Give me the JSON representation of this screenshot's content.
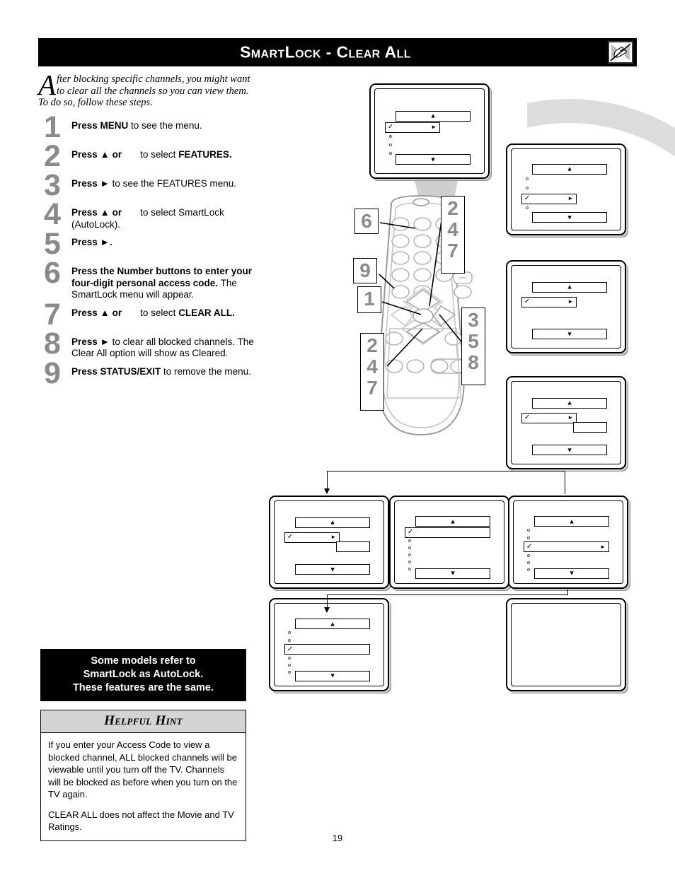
{
  "header": {
    "title": "SmartLock - Clear All",
    "icon": "tv-hand-blocked-icon"
  },
  "intro": {
    "dropcap": "A",
    "text": "fter blocking specific channels, you might want to clear all the channels so you can view them.  To do so, follow these steps."
  },
  "steps": [
    {
      "num": "1",
      "html": "<b>Press MENU</b> to see the menu."
    },
    {
      "num": "2",
      "html": "<b>Press ▲ or</b><span class=\"gap\"></span>to select <b>FEATURES.</b>"
    },
    {
      "num": "3",
      "html": "<b>Press ►</b> to see the FEATURES menu."
    },
    {
      "num": "4",
      "html": "<b>Press ▲ or</b><span class=\"gap\"></span>to select SmartLock (AutoLock)."
    },
    {
      "num": "5",
      "html": "<b>Press ►.</b>"
    },
    {
      "num": "6",
      "html": "<b>Press the Number buttons to enter your four-digit personal access code.</b> The SmartLock menu will appear."
    },
    {
      "num": "7",
      "html": "<b>Press ▲ or</b><span class=\"gap\"></span>to select <b>CLEAR ALL.</b>"
    },
    {
      "num": "8",
      "html": "<b>Press ►</b> to clear all blocked channels. The Clear All option will show as Cleared."
    },
    {
      "num": "9",
      "html": "<b>Press STATUS/EXIT</b> to remove the menu."
    }
  ],
  "note_box": {
    "line1": "Some models refer to",
    "line2": "SmartLock as AutoLock.",
    "line3": "These features are the same."
  },
  "hint": {
    "heading": "Helpful Hint",
    "paragraph1": "If you enter your Access Code to view a blocked channel, ALL blocked channels will be viewable until you turn off the TV. Channels will be blocked as before when you turn on the TV again.",
    "paragraph2": "CLEAR ALL does not affect the Movie and TV Ratings."
  },
  "page_number": "19",
  "remote_callouts": [
    {
      "name": "callout-6",
      "text": "6"
    },
    {
      "name": "callout-247-top",
      "text": "2\n4\n7"
    },
    {
      "name": "callout-9",
      "text": "9"
    },
    {
      "name": "callout-1",
      "text": "1"
    },
    {
      "name": "callout-247-bottom",
      "text": "2\n4\n7"
    },
    {
      "name": "callout-358",
      "text": "3\n5\n8"
    }
  ],
  "screens": [
    {
      "name": "tv-screen-main-menu"
    },
    {
      "name": "tv-screen-features-menu"
    },
    {
      "name": "tv-screen-smartlock"
    },
    {
      "name": "tv-screen-access-code"
    },
    {
      "name": "tv-screen-smartlock-menu"
    },
    {
      "name": "tv-screen-clear-all-list"
    },
    {
      "name": "tv-screen-clear-all-selected"
    },
    {
      "name": "tv-screen-cleared"
    },
    {
      "name": "tv-screen-blank"
    }
  ],
  "colors": {
    "header_bg": "#000000",
    "step_number": "#8a8a8a",
    "hint_header_bg": "#d4d4d4",
    "swoosh": "#dcdcdc"
  }
}
